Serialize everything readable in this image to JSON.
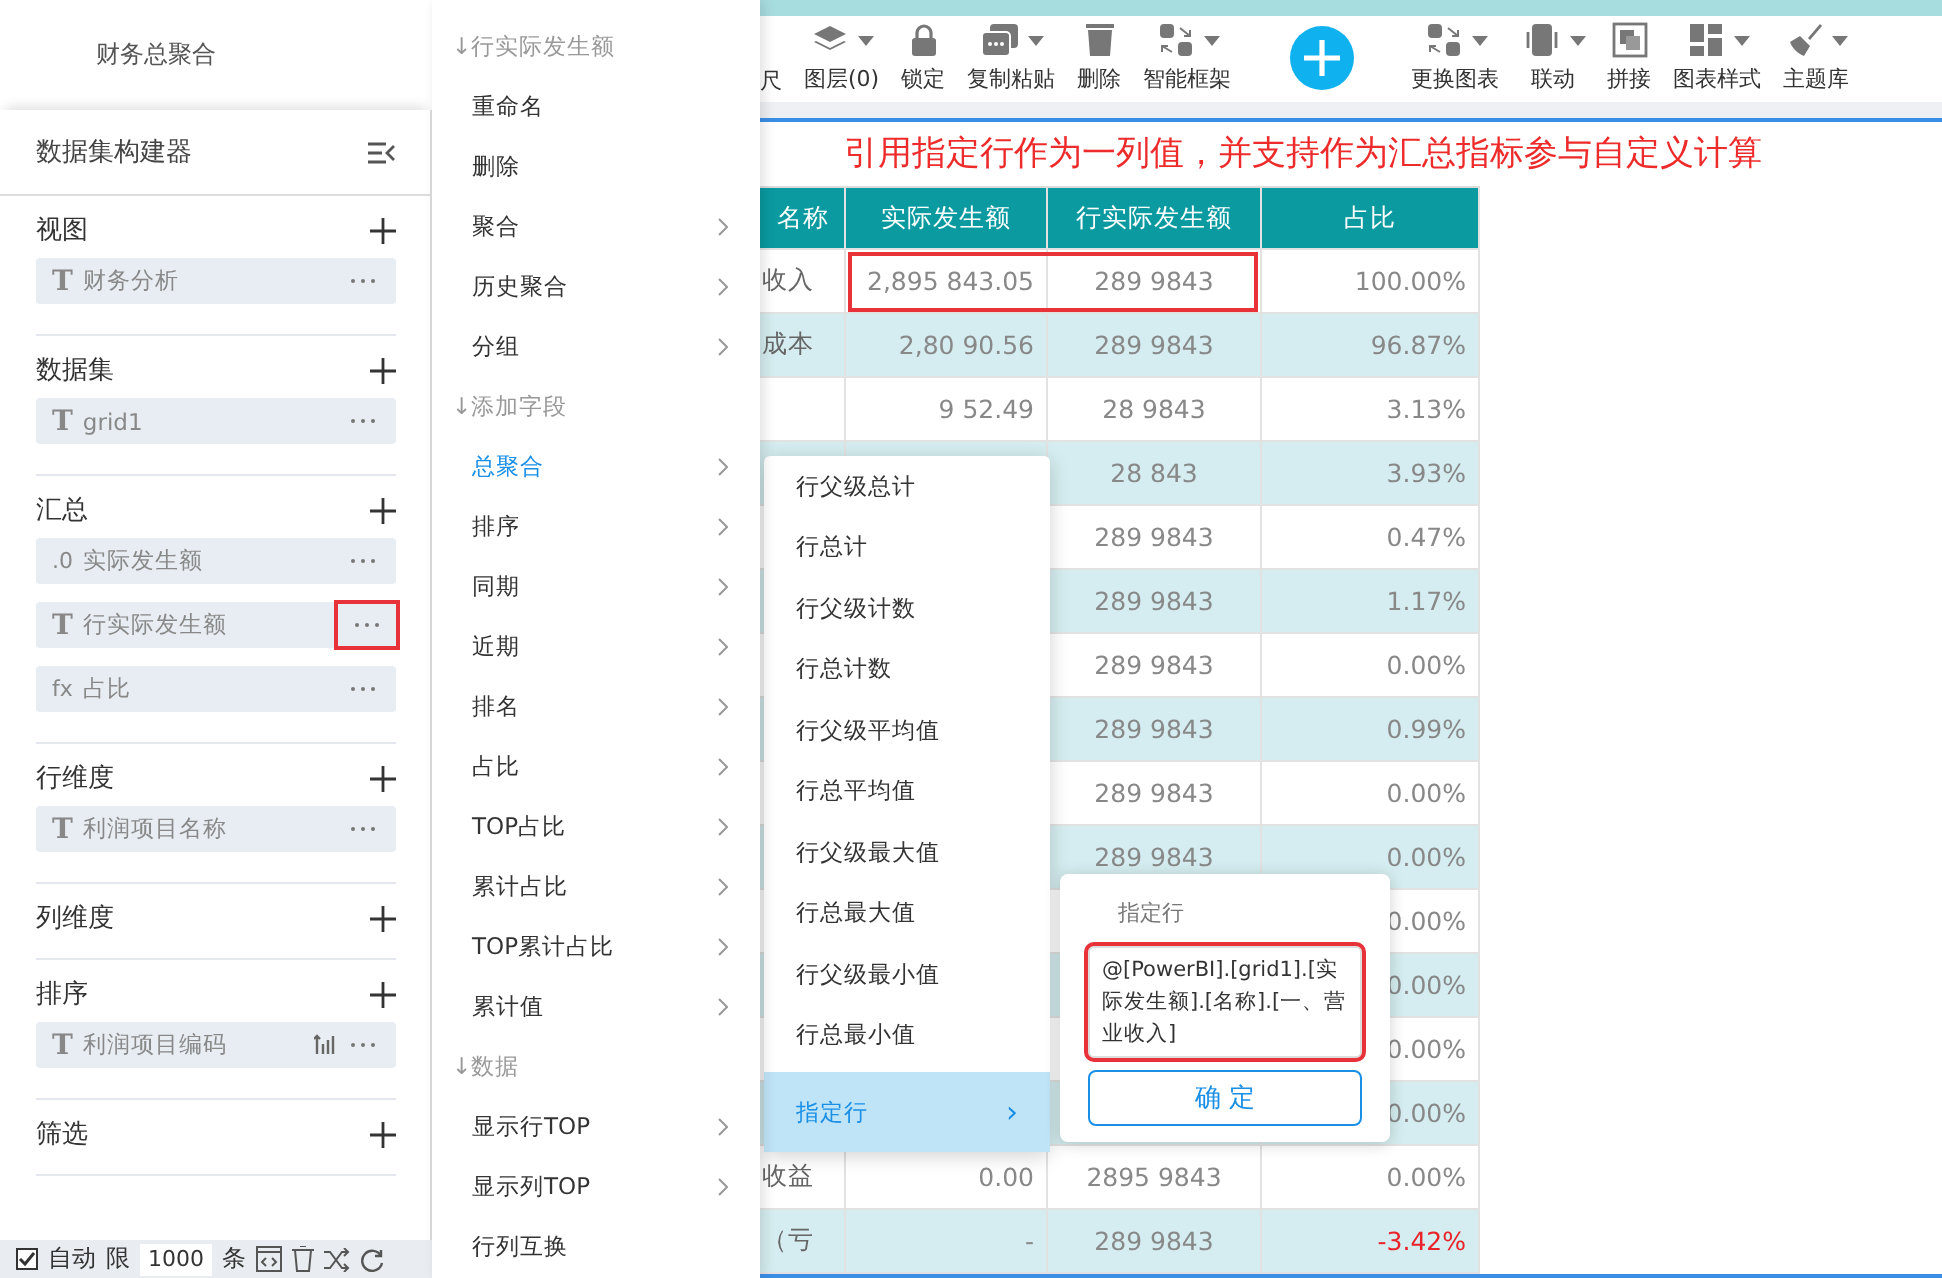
{
  "left_panel": {
    "title": "财务总聚合",
    "builder_title": "数据集构建器",
    "sections": [
      {
        "label": "视图",
        "items": [
          {
            "badge": "T",
            "label": "财务分析",
            "sortable": false,
            "highlighted": false
          }
        ]
      },
      {
        "label": "数据集",
        "items": [
          {
            "badge": "T",
            "label": "grid1",
            "sortable": false,
            "highlighted": false
          }
        ]
      },
      {
        "label": "汇总",
        "items": [
          {
            "badge": ".0",
            "label": "实际发生额",
            "sortable": false,
            "highlighted": false
          },
          {
            "badge": "T",
            "label": "行实际发生额",
            "sortable": false,
            "highlighted": true
          },
          {
            "badge": "fx",
            "label": "占比",
            "sortable": false,
            "highlighted": false
          }
        ]
      },
      {
        "label": "行维度",
        "items": [
          {
            "badge": "T",
            "label": "利润项目名称",
            "sortable": false,
            "highlighted": false
          }
        ]
      },
      {
        "label": "列维度"
      },
      {
        "label": "排序",
        "items": [
          {
            "badge": "T",
            "label": "利润项目编码",
            "sortable": true,
            "highlighted": false
          }
        ]
      },
      {
        "label": "筛选"
      }
    ],
    "footer": {
      "auto_checked": true,
      "auto_label": "自动",
      "limit_label": "限",
      "limit_value": "1000",
      "unit": "条"
    }
  },
  "context_menu": [
    {
      "kind": "header",
      "label": "↓行实际发生额"
    },
    {
      "kind": "item",
      "label": "重命名",
      "submenu": false,
      "active": false
    },
    {
      "kind": "item",
      "label": "删除",
      "submenu": false,
      "active": false
    },
    {
      "kind": "item",
      "label": "聚合",
      "submenu": true,
      "active": false
    },
    {
      "kind": "item",
      "label": "历史聚合",
      "submenu": true,
      "active": false
    },
    {
      "kind": "item",
      "label": "分组",
      "submenu": true,
      "active": false
    },
    {
      "kind": "header",
      "label": "↓添加字段"
    },
    {
      "kind": "item",
      "label": "总聚合",
      "submenu": true,
      "active": true
    },
    {
      "kind": "item",
      "label": "排序",
      "submenu": true,
      "active": false
    },
    {
      "kind": "item",
      "label": "同期",
      "submenu": true,
      "active": false
    },
    {
      "kind": "item",
      "label": "近期",
      "submenu": true,
      "active": false
    },
    {
      "kind": "item",
      "label": "排名",
      "submenu": true,
      "active": false
    },
    {
      "kind": "item",
      "label": "占比",
      "submenu": true,
      "active": false
    },
    {
      "kind": "item",
      "label": "TOP占比",
      "submenu": true,
      "active": false
    },
    {
      "kind": "item",
      "label": "累计占比",
      "submenu": true,
      "active": false
    },
    {
      "kind": "item",
      "label": "TOP累计占比",
      "submenu": true,
      "active": false
    },
    {
      "kind": "item",
      "label": "累计值",
      "submenu": true,
      "active": false
    },
    {
      "kind": "header",
      "label": "↓数据"
    },
    {
      "kind": "item",
      "label": "显示行TOP",
      "submenu": true,
      "active": false
    },
    {
      "kind": "item",
      "label": "显示列TOP",
      "submenu": true,
      "active": false
    },
    {
      "kind": "item",
      "label": "行列互换",
      "submenu": false,
      "active": false
    }
  ],
  "toolbar": [
    {
      "kind": "cut",
      "label": "尺"
    },
    {
      "kind": "layers",
      "label": "图层(0)",
      "dropdown": true
    },
    {
      "kind": "lock",
      "label": "锁定",
      "dropdown": false
    },
    {
      "kind": "copy",
      "label": "复制粘贴",
      "dropdown": true
    },
    {
      "kind": "trash",
      "label": "删除",
      "dropdown": false
    },
    {
      "kind": "frame",
      "label": "智能框架",
      "dropdown": true
    },
    {
      "kind": "add"
    },
    {
      "kind": "frame",
      "label": "更换图表",
      "dropdown": true
    },
    {
      "kind": "link",
      "label": "联动",
      "dropdown": true
    },
    {
      "kind": "join",
      "label": "拼接",
      "dropdown": false
    },
    {
      "kind": "grid",
      "label": "图表样式",
      "dropdown": true
    },
    {
      "kind": "brush",
      "label": "主题库",
      "dropdown": true
    }
  ],
  "annotation": "引用指定行作为一列值，并支持作为汇总指标参与自定义计算",
  "table": {
    "first_row_boxed": true,
    "columns": [
      "名称",
      "实际发生额",
      "行实际发生额",
      "占比"
    ],
    "rows": [
      {
        "name": "收入",
        "actual": "2,895 843.05",
        "row_actual": "289 9843",
        "ratio": "100.00%",
        "negative": false
      },
      {
        "name": "成本",
        "actual": "2,80 90.56",
        "row_actual": "289 9843",
        "ratio": "96.87%",
        "negative": false
      },
      {
        "actual": "9 52.49",
        "row_actual": "28 9843",
        "ratio": "3.13%",
        "negative": false
      },
      {
        "row_actual": "28 843",
        "ratio": "3.93%",
        "negative": false
      },
      {
        "row_actual": "289 9843",
        "ratio": "0.47%",
        "negative": false
      },
      {
        "row_actual": "289 9843",
        "ratio": "1.17%",
        "negative": false
      },
      {
        "row_actual": "289 9843",
        "ratio": "0.00%",
        "negative": false
      },
      {
        "row_actual": "289 9843",
        "ratio": "0.99%",
        "negative": false
      },
      {
        "row_actual": "289 9843",
        "ratio": "0.00%",
        "negative": false
      },
      {
        "row_actual": "289 9843",
        "ratio": "0.00%",
        "negative": false
      },
      {
        "ratio": "0.00%",
        "negative": false
      },
      {
        "ratio": "0.00%",
        "negative": false
      },
      {
        "ratio": "0.00%",
        "negative": false
      },
      {
        "ratio": "0.00%",
        "negative": false
      },
      {
        "name": "收益",
        "actual": "0.00",
        "row_actual": "2895 9843",
        "ratio": "0.00%",
        "negative": false
      },
      {
        "name": "（亏",
        "actual": "-",
        "row_actual": "289 9843",
        "ratio": "-3.42%",
        "negative": true
      }
    ]
  },
  "submenu": [
    {
      "label": "行父级总计",
      "selected": false
    },
    {
      "label": "行总计",
      "selected": false
    },
    {
      "label": "行父级计数",
      "selected": false
    },
    {
      "label": "行总计数",
      "selected": false
    },
    {
      "label": "行父级平均值",
      "selected": false
    },
    {
      "label": "行总平均值",
      "selected": false
    },
    {
      "label": "行父级最大值",
      "selected": false
    },
    {
      "label": "行总最大值",
      "selected": false
    },
    {
      "label": "行父级最小值",
      "selected": false
    },
    {
      "label": "行总最小值",
      "selected": false
    },
    {
      "label": "指定行",
      "selected": true,
      "arrow": "›"
    }
  ],
  "popup": {
    "title": "指定行",
    "value": "@[PowerBI].[grid1].[实际发生额].[名称].[一、营业收入]",
    "highlighted": true,
    "button": "确 定"
  }
}
